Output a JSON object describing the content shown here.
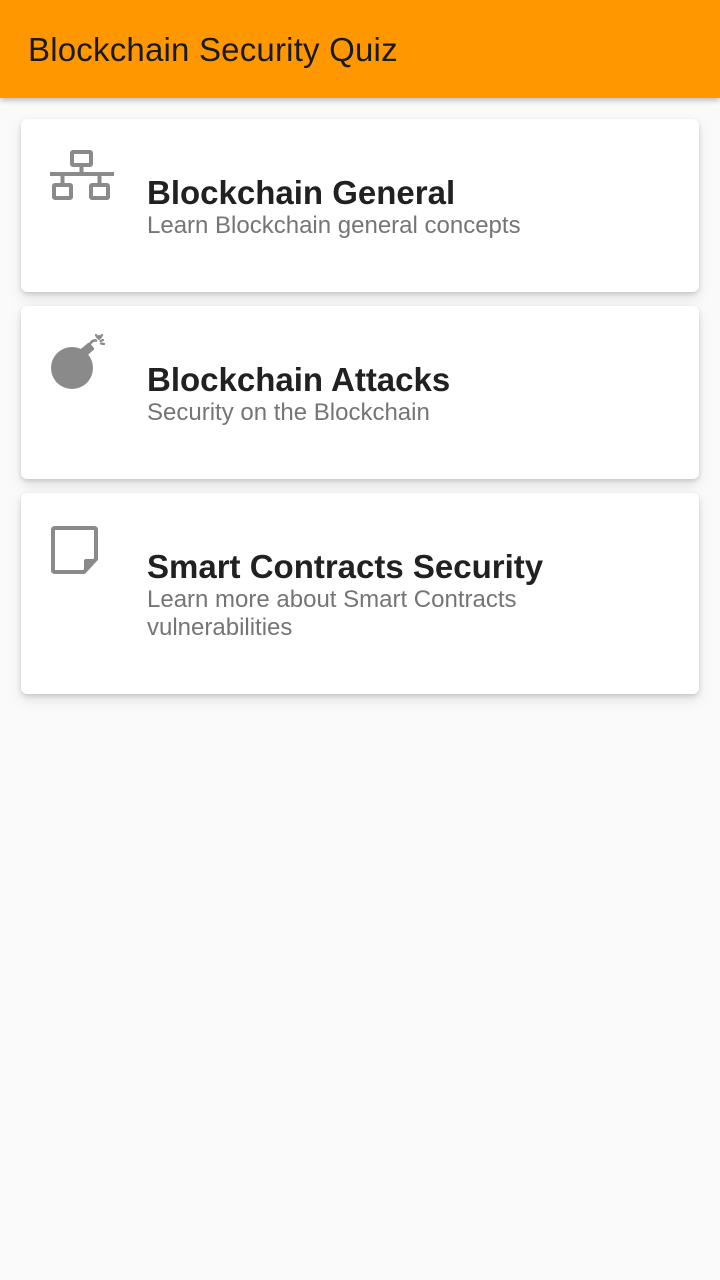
{
  "app_bar": {
    "title": "Blockchain Security Quiz",
    "background_color": "#ff9800"
  },
  "categories": [
    {
      "icon": "network-icon",
      "title": "Blockchain General",
      "subtitle": "Learn Blockchain general concepts"
    },
    {
      "icon": "bomb-icon",
      "title": "Blockchain Attacks",
      "subtitle": "Security on the Blockchain"
    },
    {
      "icon": "sticky-note-icon",
      "title": "Smart Contracts Security",
      "subtitle": "Learn more about Smart Contracts vulnerabilities"
    }
  ]
}
